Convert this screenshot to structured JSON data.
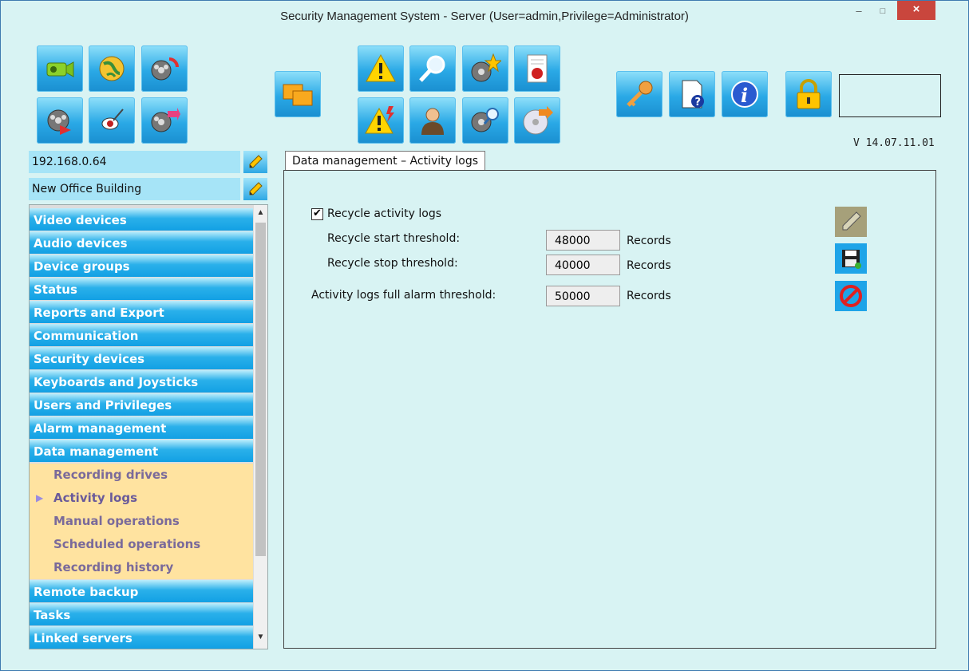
{
  "window": {
    "title": "Security Management System - Server (User=admin,Privilege=Administrator)",
    "minimize": "–",
    "maximize": "□",
    "close": "×"
  },
  "toolbar": {
    "icons": [
      "camera-icon",
      "globe-icon",
      "film-refresh-icon",
      "film-play-icon",
      "tuning-icon",
      "film-export-icon",
      "screens-icon",
      "alarm-icon",
      "search-icon",
      "film-star-icon",
      "report-icon",
      "alarm-flash-icon",
      "user-icon",
      "film-search-icon",
      "disc-export-icon",
      "key-icon",
      "help-doc-icon",
      "info-icon",
      "lock-icon"
    ]
  },
  "version": "V 14.07.11.01",
  "server_ip": "192.168.0.64",
  "site_name": "New Office Building",
  "nav": {
    "categories_top": [
      "Video devices",
      "Audio devices",
      "Device groups",
      "Status",
      "Reports and Export",
      "Communication",
      "Security devices",
      "Keyboards and Joysticks",
      "Users and Privileges",
      "Alarm management",
      "Data management"
    ],
    "sub_items": [
      "Recording drives",
      "Activity logs",
      "Manual operations",
      "Scheduled operations",
      "Recording history"
    ],
    "active_sub": "Activity logs",
    "categories_bottom": [
      "Remote backup",
      "Tasks",
      "Linked servers"
    ]
  },
  "tab": {
    "label": "Data management – Activity logs"
  },
  "form": {
    "recycle_label": "Recycle activity logs",
    "recycle_checked": true,
    "start_label": "Recycle start threshold:",
    "start_value": "48000",
    "stop_label": "Recycle stop threshold:",
    "stop_value": "40000",
    "full_label": "Activity logs full alarm threshold:",
    "full_value": "50000",
    "unit": "Records"
  },
  "actions": [
    "edit-icon",
    "save-icon",
    "cancel-icon"
  ]
}
